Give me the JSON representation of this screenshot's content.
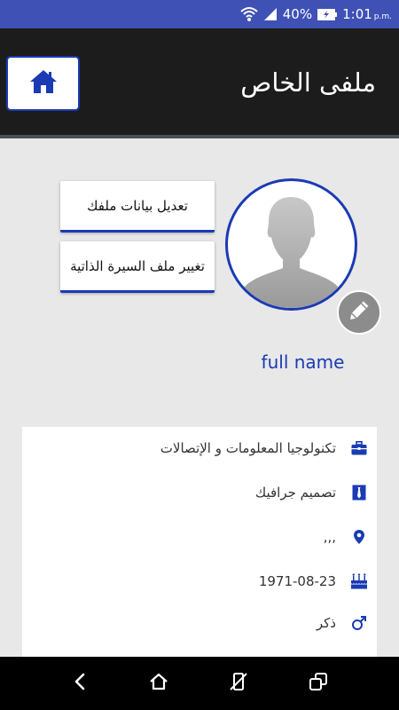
{
  "status_bar": {
    "battery_percent": "40%",
    "time": "1:01",
    "ampm": "p.m."
  },
  "app_bar": {
    "title": "ملفى الخاص",
    "home_icon": "home-icon"
  },
  "actions": {
    "edit_profile_label": "تعديل بيانات ملفك",
    "change_cv_label": "تغيير ملف السيرة الذاتية"
  },
  "profile": {
    "full_name": "full name",
    "edit_photo_icon": "pencil-icon"
  },
  "info": [
    {
      "icon": "briefcase-icon",
      "text": "تكنولوجيا المعلومات و الإتصالات"
    },
    {
      "icon": "tie-icon",
      "text": "تصميم جرافيك"
    },
    {
      "icon": "location-pin-icon",
      "text": ",,,"
    },
    {
      "icon": "birthday-cake-icon",
      "text": "1971-08-23"
    },
    {
      "icon": "male-gender-icon",
      "text": "ذكر"
    }
  ],
  "colors": {
    "accent": "#1a3bb3",
    "status_bar": "#3f51b5",
    "app_bar": "#1c1c1c"
  }
}
